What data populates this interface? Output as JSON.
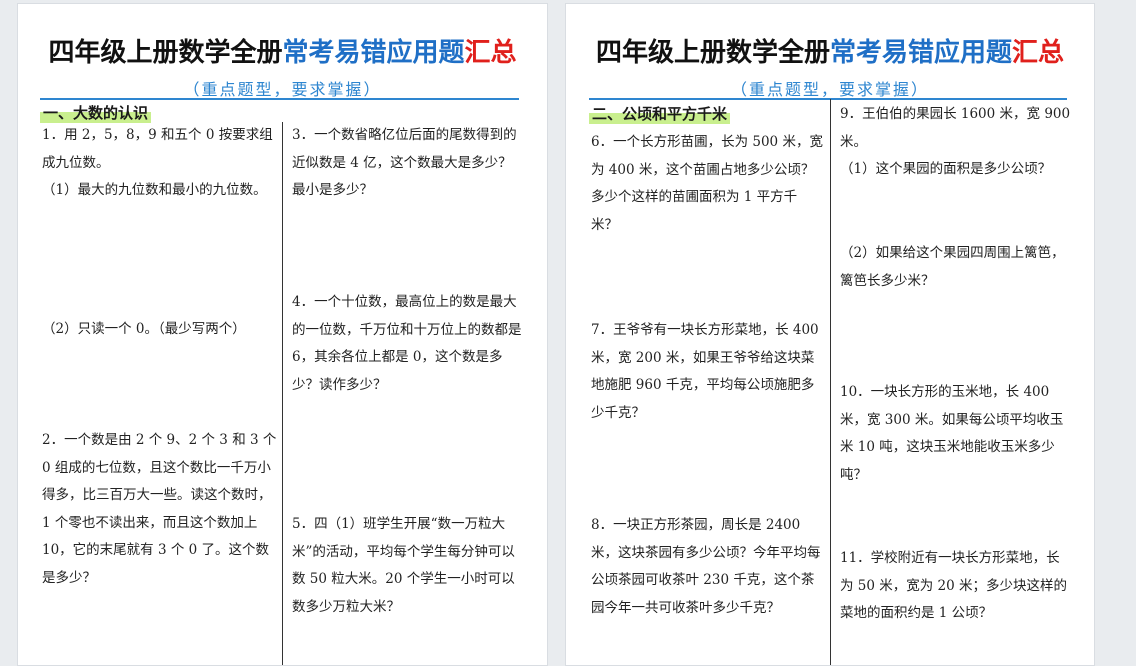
{
  "pages": [
    {
      "title": {
        "black": "四年级上册数学全册",
        "blue": "常考易错应用题",
        "red": "汇总"
      },
      "subtitle": "（重点题型，要求掌握）",
      "section": "一、大数的认识",
      "questions": {
        "q1": "1．用 2，5，8，9 和五个 0 按要求组成九位数。",
        "q1_1": "（1）最大的九位数和最小的九位数。",
        "q1_2": "（2）只读一个 0。（最少写两个）",
        "q2": "2．一个数是由 2 个 9、2 个 3 和 3 个 0 组成的七位数，且这个数比一千万小得多，比三百万大一些。读这个数时，1 个零也不读出来，而且这个数加上 10，它的末尾就有 3 个 0 了。这个数是多少？",
        "q3": "3．一个数省略亿位后面的尾数得到的近似数是 4 亿，这个数最大是多少？最小是多少？",
        "q4": "4．一个十位数，最高位上的数是最大的一位数，千万位和十万位上的数都是 6，其余各位上都是 0，这个数是多少？读作多少？",
        "q5": "5．四（1）班学生开展“数一万粒大米”的活动，平均每个学生每分钟可以数 50 粒大米。20 个学生一小时可以数多少万粒大米？"
      }
    },
    {
      "title": {
        "black": "四年级上册数学全册",
        "blue": "常考易错应用题",
        "red": "汇总"
      },
      "subtitle": "（重点题型，要求掌握）",
      "section": "二、公顷和平方千米",
      "questions": {
        "q6": "6．一个长方形苗圃，长为 500 米，宽为 400 米，这个苗圃占地多少公顷？多少个这样的苗圃面积为 1 平方千米？",
        "q7": "7．王爷爷有一块长方形菜地，长 400 米，宽 200 米，如果王爷爷给这块菜地施肥 960 千克，平均每公顷施肥多少千克？",
        "q8": "8．一块正方形茶园，周长是 2400 米，这块茶园有多少公顷？今年平均每公顷茶园可收茶叶 230 千克，这个茶园今年一共可收茶叶多少千克？",
        "q9": "9．王伯伯的果园长 1600 米，宽 900 米。",
        "q9_1": "（1）这个果园的面积是多少公顷？",
        "q9_2": "（2）如果给这个果园四周围上篱笆，篱笆长多少米？",
        "q10": "10．一块长方形的玉米地，长 400 米，宽 300 米。如果每公顷平均收玉米 10 吨，这块玉米地能收玉米多少吨？",
        "q11": "11．学校附近有一块长方形菜地，长为 50 米，宽为 20 米；多少块这样的菜地的面积约是 1 公顷？"
      }
    }
  ]
}
